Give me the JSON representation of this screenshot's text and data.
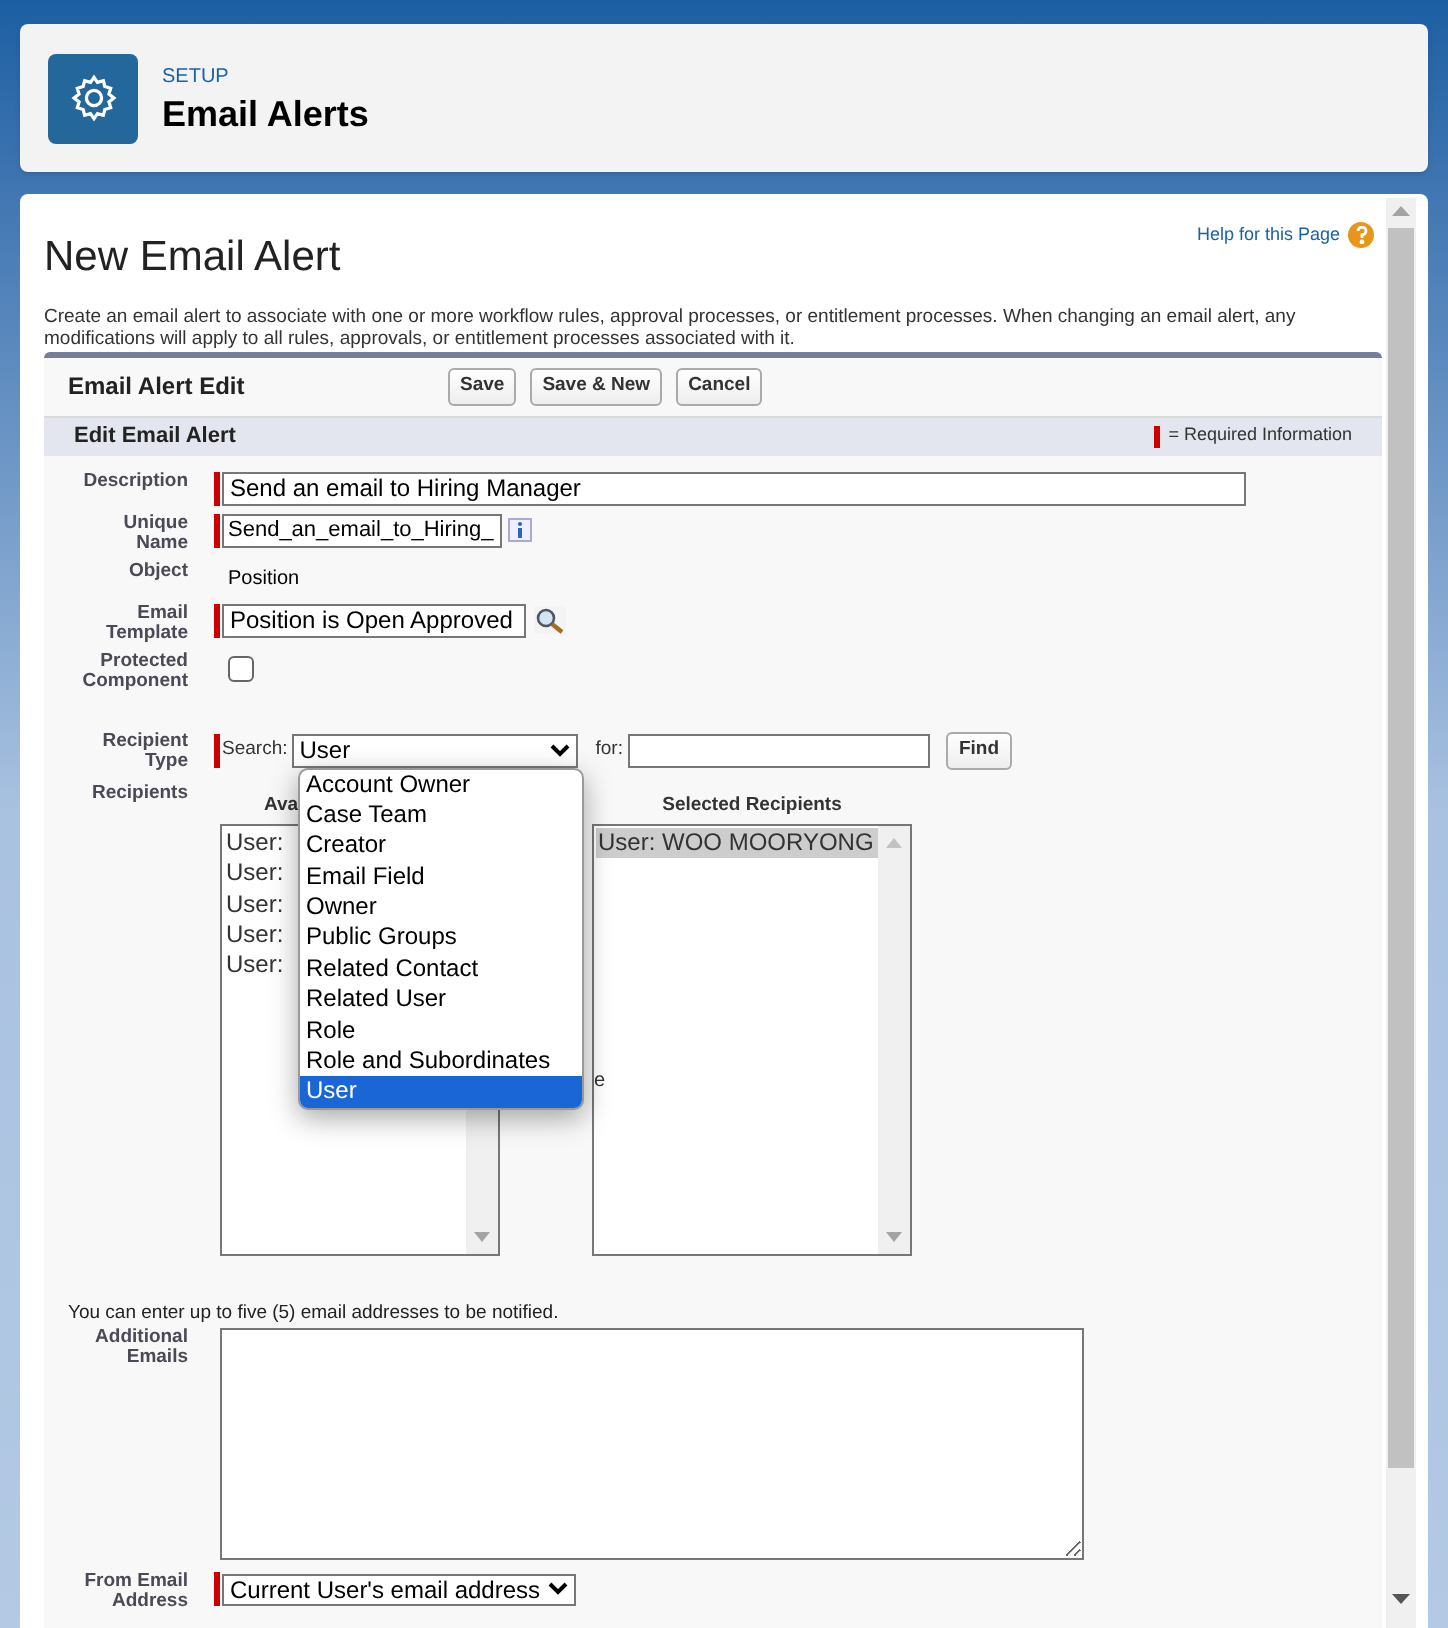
{
  "header": {
    "section": "SETUP",
    "title": "Email Alerts"
  },
  "page": {
    "title": "New Email Alert",
    "help_link": "Help for this Page",
    "description": "Create an email alert to associate with one or more workflow rules, approval processes, or entitlement processes. When changing an email alert, any modifications will apply to all rules, approvals, or entitlement processes associated with it."
  },
  "form": {
    "title": "Email Alert Edit",
    "buttons": [
      "Save",
      "Save & New",
      "Cancel"
    ],
    "section_title": "Edit Email Alert",
    "required_legend": "= Required Information"
  },
  "fields": [
    {
      "kind": "text",
      "label": "Description",
      "value": "Send an email to Hiring Manager",
      "required": true
    },
    {
      "kind": "info-text",
      "label": "Unique Name",
      "value": "Send_an_email_to_Hiring_",
      "required": true
    },
    {
      "kind": "readonly",
      "label": "Object",
      "value": "Position",
      "required": false
    },
    {
      "kind": "lookup",
      "label": "Email Template",
      "value": "Position is Open Approved",
      "required": true
    },
    {
      "kind": "checkbox",
      "label": "Protected Component",
      "checked": false,
      "required": false
    }
  ],
  "recipient_type": {
    "label": "Recipient Type",
    "required": true,
    "search_label": "Search:",
    "value": "User",
    "for_label": "for:",
    "find_button": "Find",
    "options": [
      {
        "label": "Account Owner",
        "selected": false
      },
      {
        "label": "Case Team",
        "selected": false
      },
      {
        "label": "Creator",
        "selected": false
      },
      {
        "label": "Email Field",
        "selected": false
      },
      {
        "label": "Owner",
        "selected": false
      },
      {
        "label": "Public Groups",
        "selected": false
      },
      {
        "label": "Related Contact",
        "selected": false
      },
      {
        "label": "Related User",
        "selected": false
      },
      {
        "label": "Role",
        "selected": false
      },
      {
        "label": "Role and Subordinates",
        "selected": false
      },
      {
        "label": "User",
        "selected": true
      }
    ]
  },
  "recipients": {
    "label": "Recipients",
    "available_heading": "Ava",
    "available_items": [
      "User:",
      "User:",
      "User:",
      "User:",
      "User:"
    ],
    "button_fragment": "e",
    "selected_heading": "Selected Recipients",
    "selected_items": [
      {
        "label": "User: WOO MOORYONG",
        "selected": true
      }
    ]
  },
  "additional_emails": {
    "note": "You can enter up to five (5) email addresses to be notified.",
    "label": "Additional Emails"
  },
  "from_address": {
    "label": "From Email Address",
    "value": "Current User's email address",
    "required": true
  }
}
